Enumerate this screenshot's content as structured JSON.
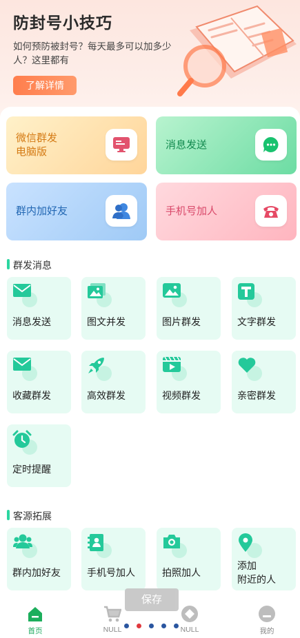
{
  "hero": {
    "title": "防封号小技巧",
    "subtitle": "如何预防被封号？每天最多可以加多少人？这里都有",
    "button_label": "了解详情"
  },
  "feature_cards": {
    "wechat_pc": "微信群发\n电脑版",
    "message_send": "消息发送",
    "group_add_friends": "群内加好友",
    "phone_add": "手机号加人"
  },
  "sections": {
    "group_send": {
      "title": "群发消息",
      "items": [
        {
          "label": "消息发送",
          "icon": "envelope-icon"
        },
        {
          "label": "图文并发",
          "icon": "image-text-icon"
        },
        {
          "label": "图片群发",
          "icon": "picture-icon"
        },
        {
          "label": "文字群发",
          "icon": "text-icon"
        },
        {
          "label": "收藏群发",
          "icon": "envelope-icon"
        },
        {
          "label": "高效群发",
          "icon": "rocket-icon"
        },
        {
          "label": "视频群发",
          "icon": "video-icon"
        },
        {
          "label": "亲密群发",
          "icon": "heart-icon"
        },
        {
          "label": "定时提醒",
          "icon": "alarm-clock-icon"
        }
      ]
    },
    "customer": {
      "title": "客源拓展",
      "items": [
        {
          "label": "群内加好友",
          "icon": "group-people-icon"
        },
        {
          "label": "手机号加人",
          "icon": "contact-book-icon"
        },
        {
          "label": "拍照加人",
          "icon": "camera-icon"
        },
        {
          "label": "添加\n附近的人",
          "icon": "location-pin-icon"
        }
      ]
    }
  },
  "save_label": "保存",
  "bottom_nav": {
    "home": "首页",
    "null1": "NULL",
    "null2": "NULL",
    "mine": "我的"
  },
  "colors": {
    "accent": "#2bd6a0",
    "tile_bg": "#e6fbf3",
    "nav_active": "#1ca95e",
    "hero_button": "#ff7e4d"
  }
}
